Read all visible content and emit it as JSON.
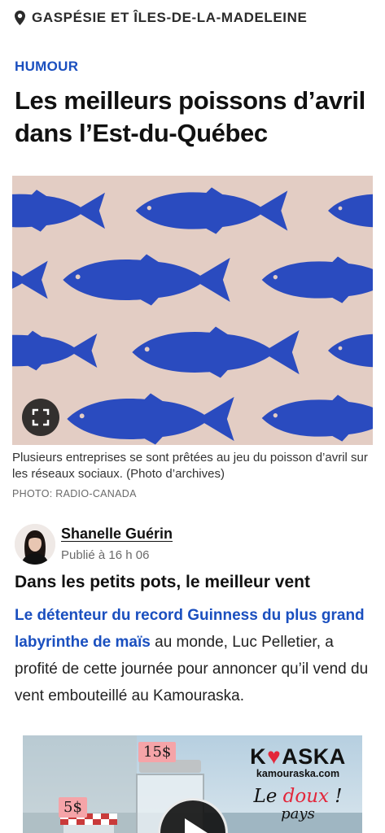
{
  "region": {
    "icon": "location-pin-icon",
    "label": "GASPÉSIE ET ÎLES-DE-LA-MADELEINE"
  },
  "article": {
    "rubric": "HUMOUR",
    "title": "Les meilleurs poissons d’avril dans l’Est-du-Québec",
    "caption": "Plusieurs entreprises se sont prêtées au jeu du poisson d’avril sur les réseaux sociaux. (Photo d’archives)",
    "credit": "PHOTO: RADIO-CANADA",
    "author": "Shanelle Guérin",
    "published": "Publié à 16 h 06",
    "subhead": "Dans les petits pots, le meilleur vent",
    "body": {
      "link": "Le détenteur du record Guinness du plus grand labyrinthe de maïs",
      "rest": " au monde, Luc Pelletier, a profité de cette journée pour annoncer qu’il vend du vent embouteillé au Kamouraska."
    }
  },
  "video": {
    "price_large": "15$",
    "price_small": "5$",
    "brand_prefix": "K",
    "brand_heart": "♥",
    "brand_suffix": "ASKA",
    "brand_url": "kamouraska.com",
    "slogan_le": "Le ",
    "slogan_doux": "doux",
    "slogan_mark": " !",
    "slogan_next": "pays"
  },
  "colors": {
    "accent": "#1a4fbf",
    "fish": "#2a4bbf",
    "hero_background": "#e3cdc4",
    "brand_red": "#e3263a",
    "price_tag": "#f5a4a8"
  }
}
